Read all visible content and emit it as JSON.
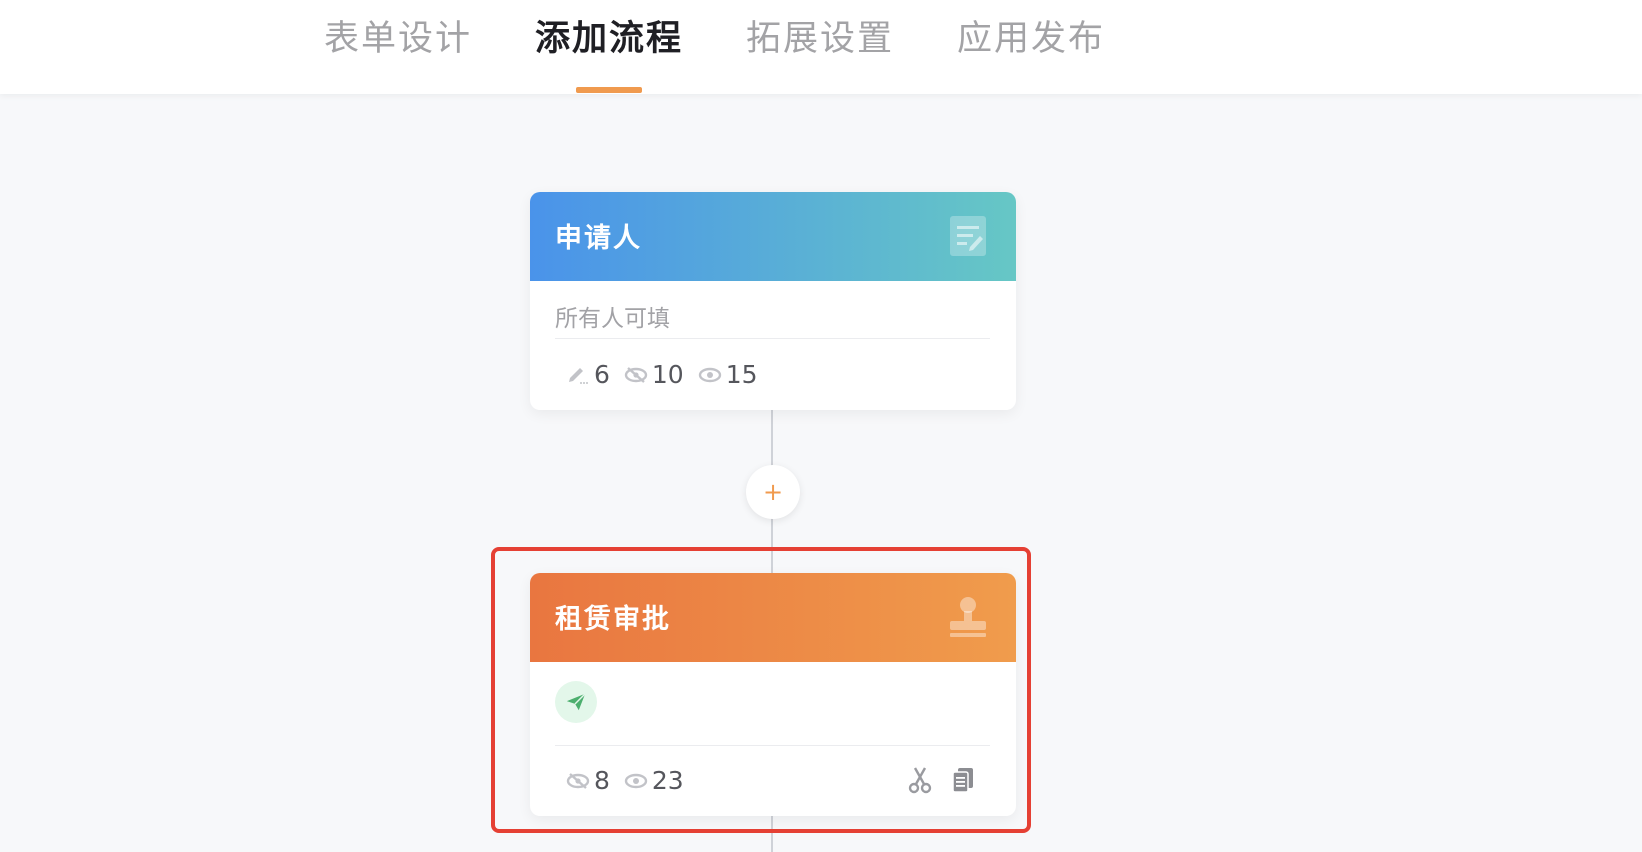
{
  "tabs": [
    {
      "label": "表单设计",
      "active": false
    },
    {
      "label": "添加流程",
      "active": true
    },
    {
      "label": "拓展设置",
      "active": false
    },
    {
      "label": "应用发布",
      "active": false
    }
  ],
  "accent_color": "#f09a4e",
  "nodes": [
    {
      "title": "申请人",
      "header_icon": "form-edit-icon",
      "description": "所有人可填",
      "stats": {
        "editable": "6",
        "hidden": "10",
        "visible": "15"
      }
    },
    {
      "title": "租赁审批",
      "header_icon": "stamp-icon",
      "badge_icon": "paper-plane-icon",
      "stats": {
        "hidden": "8",
        "visible": "23"
      },
      "actions": [
        "scissors-icon",
        "copy-icon"
      ]
    }
  ],
  "add_button": {
    "label": "+"
  }
}
